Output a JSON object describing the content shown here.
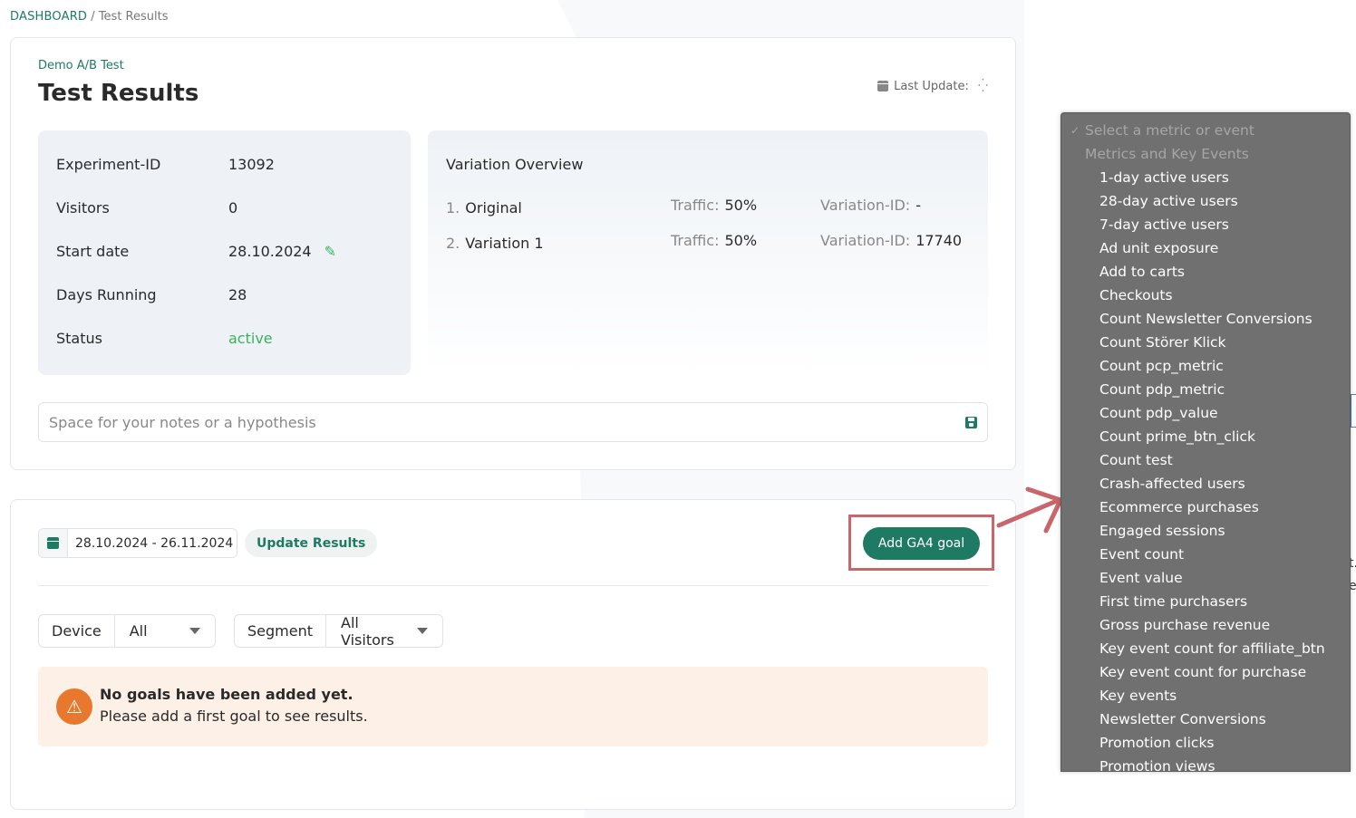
{
  "breadcrumb": {
    "home": "DASHBOARD",
    "sep": "/",
    "current": "Test Results"
  },
  "header": {
    "subtitle": "Demo A/B Test",
    "title": "Test Results",
    "last_update_label": "Last Update:",
    "last_update_spinner": "⁛"
  },
  "info": {
    "rows": [
      {
        "label": "Experiment-ID",
        "value": "13092"
      },
      {
        "label": "Visitors",
        "value": "0"
      },
      {
        "label": "Start date",
        "value": "28.10.2024"
      },
      {
        "label": "Days Running",
        "value": "28"
      },
      {
        "label": "Status",
        "value": "active"
      }
    ]
  },
  "variations": {
    "title": "Variation Overview",
    "traffic_label": "Traffic:",
    "id_label": "Variation-ID:",
    "items": [
      {
        "num": "1.",
        "name": "Original",
        "traffic": "50%",
        "id": "-"
      },
      {
        "num": "2.",
        "name": "Variation 1",
        "traffic": "50%",
        "id": "17740"
      }
    ]
  },
  "notes": {
    "placeholder": "Space for your notes or a hypothesis",
    "value": ""
  },
  "filters": {
    "date_range": "28.10.2024 - 26.11.2024",
    "update_button": "Update Results",
    "add_goal_button": "Add GA4 goal",
    "device_label": "Device",
    "device_value": "All",
    "segment_label": "Segment",
    "segment_value": "All Visitors"
  },
  "alert": {
    "heading": "No goals have been added yet.",
    "body": "Please add a first goal to see results."
  },
  "dropdown": {
    "placeholder": "Select a metric or event",
    "group": "Metrics and Key Events",
    "options": [
      "1-day active users",
      "28-day active users",
      "7-day active users",
      "Ad unit exposure",
      "Add to carts",
      "Checkouts",
      "Count Newsletter Conversions",
      "Count Störer Klick",
      "Count pcp_metric",
      "Count pdp_metric",
      "Count pdp_value",
      "Count prime_btn_click",
      "Count test",
      "Crash-affected users",
      "Ecommerce purchases",
      "Engaged sessions",
      "Event count",
      "Event value",
      "First time purchasers",
      "Gross purchase revenue",
      "Key event count for affiliate_btn",
      "Key event count for purchase",
      "Key events",
      "Newsletter Conversions",
      "Promotion clicks",
      "Promotion views"
    ]
  },
  "edge": {
    "text1": "t.",
    "text2": "e"
  },
  "colors": {
    "accent": "#1f7a63",
    "status_active": "#3ab25a",
    "highlight": "#c9666b",
    "alert_bg": "#fdf0e6",
    "alert_icon": "#e8782e"
  }
}
